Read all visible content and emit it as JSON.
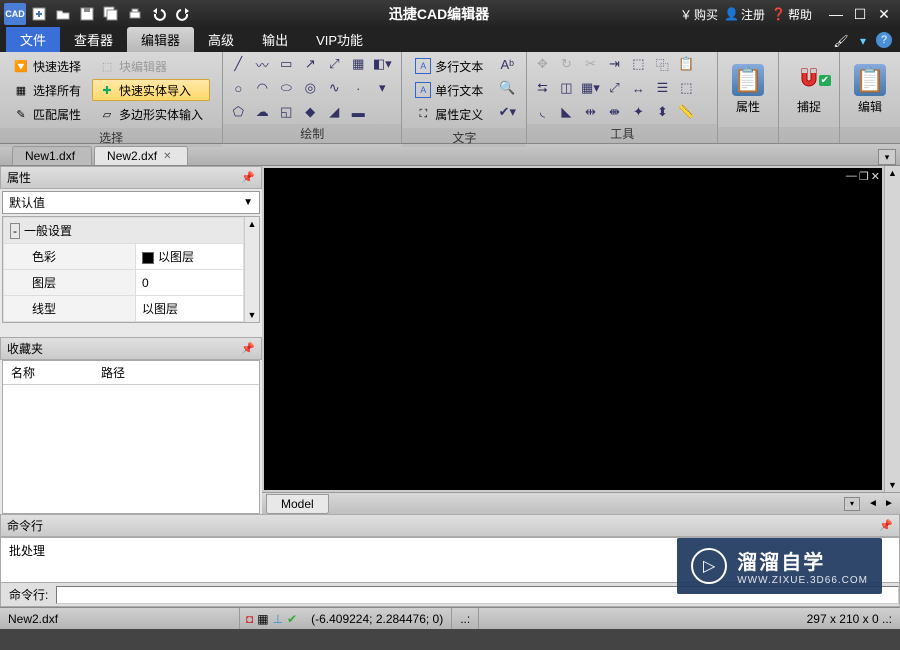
{
  "title": "迅捷CAD编辑器",
  "titlebar_right": {
    "buy": "购买",
    "register": "注册",
    "help": "帮助"
  },
  "menutabs": {
    "file": "文件",
    "viewer": "查看器",
    "editor": "编辑器",
    "advanced": "高级",
    "output": "输出",
    "vip": "VIP功能"
  },
  "ribbon": {
    "select": {
      "label": "选择",
      "quick_select": "快速选择",
      "select_all": "选择所有",
      "match_props": "匹配属性",
      "block_editor": "块编辑器",
      "quick_entity_import": "快速实体导入",
      "polygon_entity_input": "多边形实体输入"
    },
    "draw": {
      "label": "绘制"
    },
    "text": {
      "label": "文字",
      "mtext": "多行文本",
      "stext": "单行文本",
      "attdef": "属性定义"
    },
    "tools": {
      "label": "工具"
    },
    "props": {
      "label": "属性"
    },
    "snap": {
      "label": "捕捉"
    },
    "edit": {
      "label": "编辑"
    }
  },
  "doctabs": [
    "New1.dxf",
    "New2.dxf"
  ],
  "active_doc": 1,
  "prop_panel": {
    "title": "属性",
    "default": "默认值",
    "section": "一般设置",
    "rows": [
      {
        "k": "色彩",
        "v": "以图层",
        "color": true
      },
      {
        "k": "图层",
        "v": "0"
      },
      {
        "k": "线型",
        "v": "以图层"
      }
    ]
  },
  "fav_panel": {
    "title": "收藏夹",
    "col1": "名称",
    "col2": "路径"
  },
  "model_tab": "Model",
  "cmd": {
    "title": "命令行",
    "output": "批处理",
    "prompt": "命令行:"
  },
  "status": {
    "file": "New2.dxf",
    "coords": "(-6.409224; 2.284476; 0)",
    "dims": "297 x 210 x 0 ..:"
  },
  "watermark": {
    "big": "溜溜自学",
    "small": "WWW.ZIXUE.3D66.COM"
  }
}
